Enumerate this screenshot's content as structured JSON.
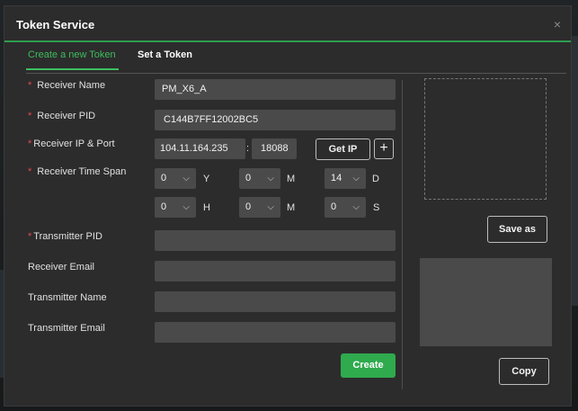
{
  "dialog": {
    "title": "Token Service",
    "close_icon": "×"
  },
  "tabs": [
    {
      "label": "Create a new Token",
      "active": true
    },
    {
      "label": "Set a Token",
      "active": false
    }
  ],
  "required_marker": "*",
  "form": {
    "receiver_name": {
      "label": "Receiver Name",
      "value": "PM_X6_A"
    },
    "receiver_pid": {
      "label": "Receiver PID",
      "value": "C144B7FF12002BC5"
    },
    "receiver_ip_port": {
      "label": "Receiver IP & Port",
      "ip": "104.11.164.235",
      "separator": ":",
      "port": "18088",
      "get_ip_label": "Get IP",
      "add_label": "+"
    },
    "receiver_time_span": {
      "label": "Receiver Time Span",
      "fields": [
        {
          "value": "0",
          "unit": "Y"
        },
        {
          "value": "0",
          "unit": "M"
        },
        {
          "value": "14",
          "unit": "D"
        },
        {
          "value": "0",
          "unit": "H"
        },
        {
          "value": "0",
          "unit": "M"
        },
        {
          "value": "0",
          "unit": "S"
        }
      ],
      "chevron": "⌵"
    },
    "transmitter_pid": {
      "label": "Transmitter PID",
      "value": ""
    },
    "receiver_email": {
      "label": "Receiver Email",
      "value": ""
    },
    "transmitter_name": {
      "label": "Transmitter Name",
      "value": ""
    },
    "transmitter_email": {
      "label": "Transmitter Email",
      "value": ""
    },
    "create_label": "Create"
  },
  "right_panel": {
    "save_as_label": "Save as",
    "copy_label": "Copy"
  },
  "colors": {
    "accent": "#3dbd5d",
    "create_button": "#2faa4d",
    "required": "#e5484d",
    "field_bg": "#4a4a4a",
    "dialog_bg": "#2c2c2c"
  }
}
